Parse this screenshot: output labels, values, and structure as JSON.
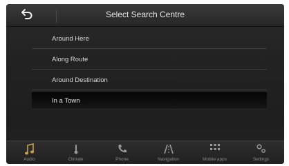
{
  "header": {
    "title": "Select Search Centre"
  },
  "options": [
    {
      "label": "Around Here"
    },
    {
      "label": "Along Route"
    },
    {
      "label": "Around Destination"
    },
    {
      "label": "In a Town"
    }
  ],
  "selected_option": "In a Town",
  "nav": [
    {
      "label": "Audio",
      "icon": "music-note-icon"
    },
    {
      "label": "Climate",
      "icon": "thermometer-icon"
    },
    {
      "label": "Phone",
      "icon": "phone-icon"
    },
    {
      "label": "Navigation",
      "icon": "navigation-road-icon"
    },
    {
      "label": "Mobile apps",
      "icon": "apps-grid-icon"
    },
    {
      "label": "Settings",
      "icon": "gears-icon"
    }
  ],
  "colors": {
    "accent": "#c9a24a",
    "background": "#222222",
    "text": "#e8e8e8"
  }
}
